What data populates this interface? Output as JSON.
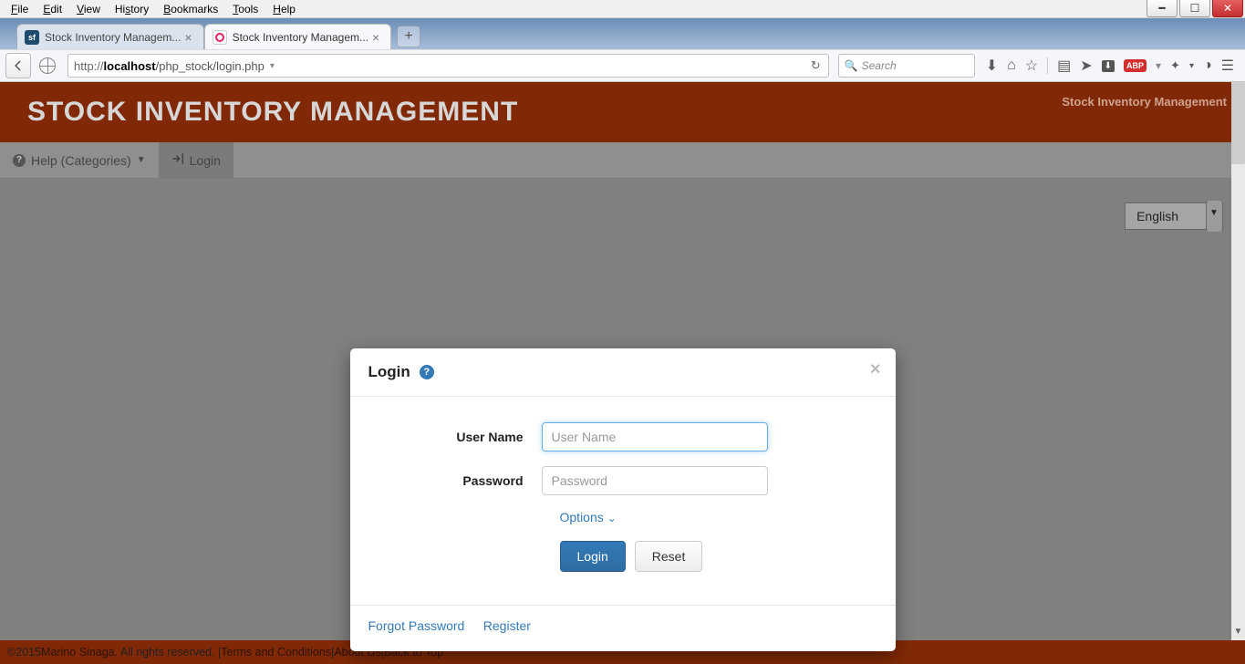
{
  "menubar": [
    "File",
    "Edit",
    "View",
    "History",
    "Bookmarks",
    "Tools",
    "Help"
  ],
  "tabs": {
    "inactive": "Stock Inventory Managem...",
    "active": "Stock Inventory Managem..."
  },
  "url": {
    "prefix": "http://",
    "host": "localhost",
    "path": "/php_stock/login.php"
  },
  "search_placeholder": "Search",
  "site": {
    "title": "STOCK INVENTORY MANAGEMENT",
    "right": "Stock Inventory Management",
    "nav_help": "Help (Categories)",
    "nav_login": "Login",
    "language": "English"
  },
  "modal": {
    "title": "Login",
    "username_label": "User Name",
    "username_placeholder": "User Name",
    "password_label": "Password",
    "password_placeholder": "Password",
    "options": "Options",
    "login_btn": "Login",
    "reset_btn": "Reset",
    "forgot": "Forgot Password",
    "register": "Register"
  },
  "footer": {
    "copyright_prefix": "©2015 ",
    "author": "Marino Sinaga",
    "rights": ". All rights reserved. | ",
    "terms": "Terms and Conditions",
    "sep1": " | ",
    "about": "About Us",
    "sep2": " | ",
    "top": "Back to Top"
  }
}
